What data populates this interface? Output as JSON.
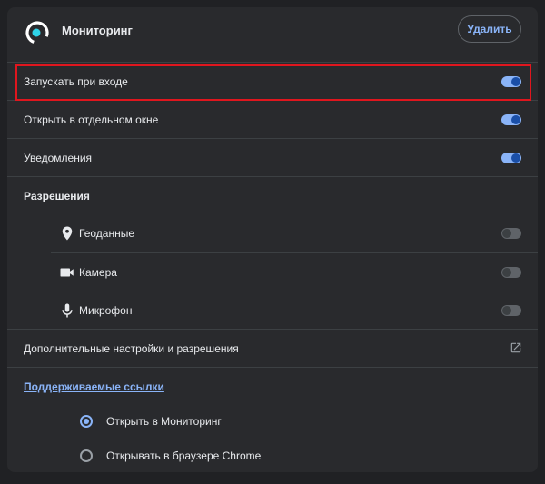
{
  "header": {
    "app_name": "Мониторинг",
    "delete_label": "Удалить"
  },
  "settings": {
    "launch_on_login": {
      "label": "Запускать при входе",
      "on": true
    },
    "open_in_window": {
      "label": "Открыть в отдельном окне",
      "on": true
    },
    "notifications": {
      "label": "Уведомления",
      "on": true
    }
  },
  "permissions": {
    "title": "Разрешения",
    "items": [
      {
        "label": "Геоданные",
        "icon": "location-pin-icon",
        "on": false
      },
      {
        "label": "Камера",
        "icon": "camera-icon",
        "on": false
      },
      {
        "label": "Микрофон",
        "icon": "microphone-icon",
        "on": false
      }
    ]
  },
  "more_settings": {
    "label": "Дополнительные настройки и разрешения",
    "icon": "open-external-icon"
  },
  "supported_links": {
    "title": "Поддерживаемые ссылки",
    "options": [
      {
        "label": "Открыть в Мониторинг",
        "selected": true
      },
      {
        "label": "Открывать в браузере Chrome",
        "selected": false
      }
    ]
  },
  "colors": {
    "background": "#202124",
    "card": "#292a2d",
    "accent": "#8ab4f8",
    "highlight_border": "#e0161e"
  }
}
